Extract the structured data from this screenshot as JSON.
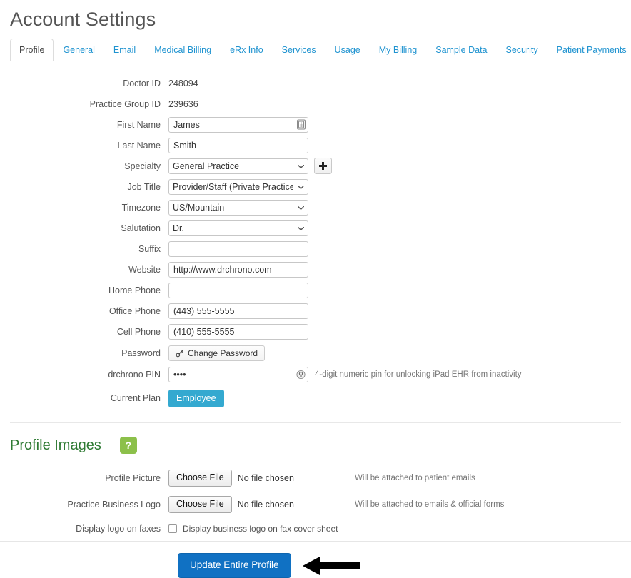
{
  "page": {
    "title": "Account Settings"
  },
  "tabs": [
    {
      "label": "Profile",
      "active": true
    },
    {
      "label": "General",
      "active": false
    },
    {
      "label": "Email",
      "active": false
    },
    {
      "label": "Medical Billing",
      "active": false
    },
    {
      "label": "eRx Info",
      "active": false
    },
    {
      "label": "Services",
      "active": false
    },
    {
      "label": "Usage",
      "active": false
    },
    {
      "label": "My Billing",
      "active": false
    },
    {
      "label": "Sample Data",
      "active": false
    },
    {
      "label": "Security",
      "active": false
    },
    {
      "label": "Patient Payments",
      "active": false
    }
  ],
  "profile": {
    "doctor_id": {
      "label": "Doctor ID",
      "value": "248094"
    },
    "practice_group_id": {
      "label": "Practice Group ID",
      "value": "239636"
    },
    "first_name": {
      "label": "First Name",
      "value": "James",
      "icon": "contact-card-icon"
    },
    "last_name": {
      "label": "Last Name",
      "value": "Smith"
    },
    "specialty": {
      "label": "Specialty",
      "value": "General Practice",
      "add_button": "add-specialty-button"
    },
    "job_title": {
      "label": "Job Title",
      "value": "Provider/Staff (Private Practice)"
    },
    "timezone": {
      "label": "Timezone",
      "value": "US/Mountain"
    },
    "salutation": {
      "label": "Salutation",
      "value": "Dr."
    },
    "suffix": {
      "label": "Suffix",
      "value": ""
    },
    "website": {
      "label": "Website",
      "value": "http://www.drchrono.com"
    },
    "home_phone": {
      "label": "Home Phone",
      "value": ""
    },
    "office_phone": {
      "label": "Office Phone",
      "value": "(443) 555-5555"
    },
    "cell_phone": {
      "label": "Cell Phone",
      "value": "(410) 555-5555"
    },
    "password": {
      "label": "Password",
      "button_label": "Change Password",
      "icon": "key-icon"
    },
    "pin": {
      "label": "drchrono PIN",
      "value": "••••",
      "icon": "password-key-icon",
      "hint": "4-digit numeric pin for unlocking iPad EHR from inactivity"
    },
    "current_plan": {
      "label": "Current Plan",
      "value": "Employee",
      "color": "#34a9d0"
    }
  },
  "profile_images": {
    "heading": "Profile Images",
    "help_icon_label": "?",
    "help_icon_color": "#8cc04a",
    "profile_picture": {
      "label": "Profile Picture",
      "button_label": "Choose File",
      "file_status": "No file chosen",
      "note": "Will be attached to patient emails"
    },
    "practice_business_logo": {
      "label": "Practice Business Logo",
      "button_label": "Choose File",
      "file_status": "No file chosen",
      "note": "Will be attached to emails & official forms"
    },
    "display_logo_on_faxes": {
      "label": "Display logo on faxes",
      "checkbox_label": "Display business logo on fax cover sheet",
      "checked": false
    }
  },
  "submit": {
    "label": "Update Entire Profile",
    "color": "#1071c3",
    "annotation": "left-pointing-arrow"
  }
}
